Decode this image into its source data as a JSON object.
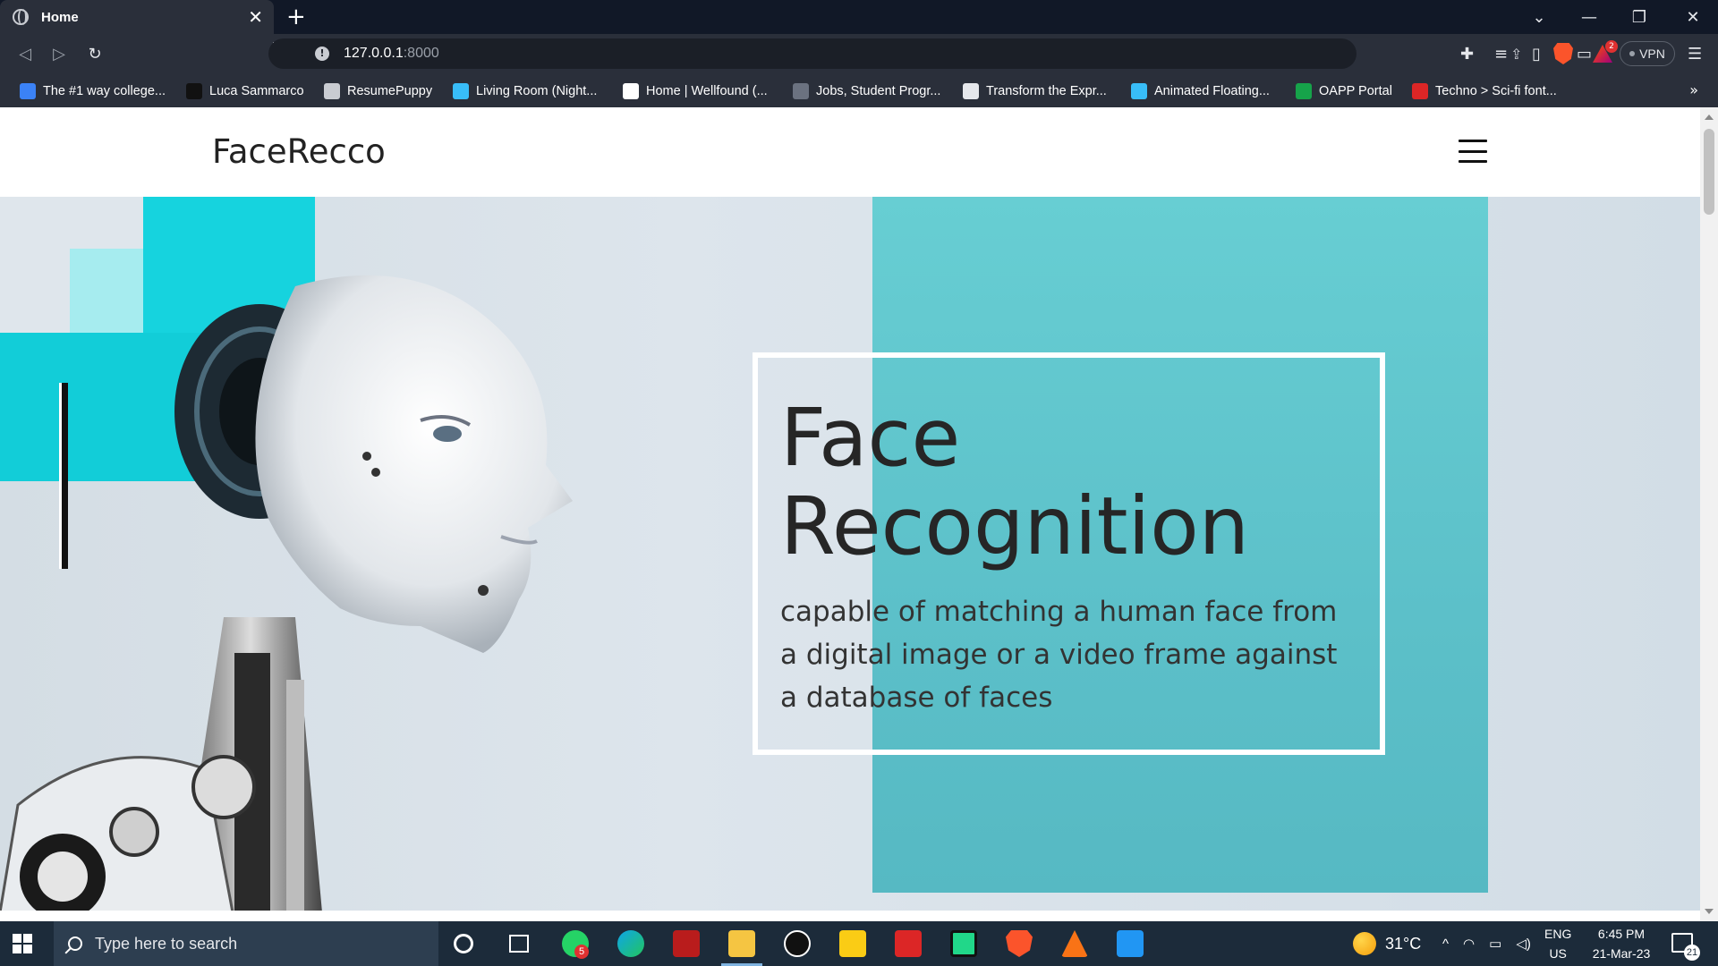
{
  "browser": {
    "tab_title": "Home",
    "url_host": "127.0.0.1",
    "url_port": ":8000",
    "vpn_label": "VPN",
    "rewards_badge": "2",
    "bookmarks": [
      {
        "label": "The #1 way college...",
        "icon": "bookmark-icon-generic",
        "color": "#3b82f6"
      },
      {
        "label": "Luca Sammarco",
        "icon": "dollar-icon",
        "color": "#111111"
      },
      {
        "label": "ResumePuppy",
        "icon": "globe-icon",
        "color": "#c9ccd2"
      },
      {
        "label": "Living Room (Night...",
        "icon": "blue-cube-icon",
        "color": "#38bdf8"
      },
      {
        "label": "Home | Wellfound (...",
        "icon": "wellfound-icon",
        "color": "#ffffff"
      },
      {
        "label": "Jobs, Student Progr...",
        "icon": "ampersand-icon",
        "color": "#6b7280"
      },
      {
        "label": "Transform the Expr...",
        "icon": "cc-icon",
        "color": "#e5e7eb"
      },
      {
        "label": "Animated Floating...",
        "icon": "blue-cube-icon",
        "color": "#38bdf8"
      },
      {
        "label": "OAPP Portal",
        "icon": "oapp-icon",
        "color": "#16a34a"
      },
      {
        "label": "Techno > Sci-fi font...",
        "icon": "dafont-icon",
        "color": "#dc2626"
      }
    ]
  },
  "page": {
    "brand": "FaceRecco",
    "hero_title_line1": "Face",
    "hero_title_line2": "Recognition",
    "hero_subtitle": "capable of matching a human face from a digital image or a video frame against a database of faces"
  },
  "taskbar": {
    "search_placeholder": "Type here to search",
    "whatsapp_badge": "5",
    "weather": "31°C",
    "lang": "ENG",
    "region": "US",
    "time": "6:45 PM",
    "date": "21-Mar-23",
    "notifications": "21"
  },
  "colors": {
    "accent_teal": "#5cc0c9",
    "cyan_block": "#16d3de",
    "tabstrip": "#111827",
    "toolbar": "#2a2f3a",
    "taskbar": "#1c2b3a"
  }
}
